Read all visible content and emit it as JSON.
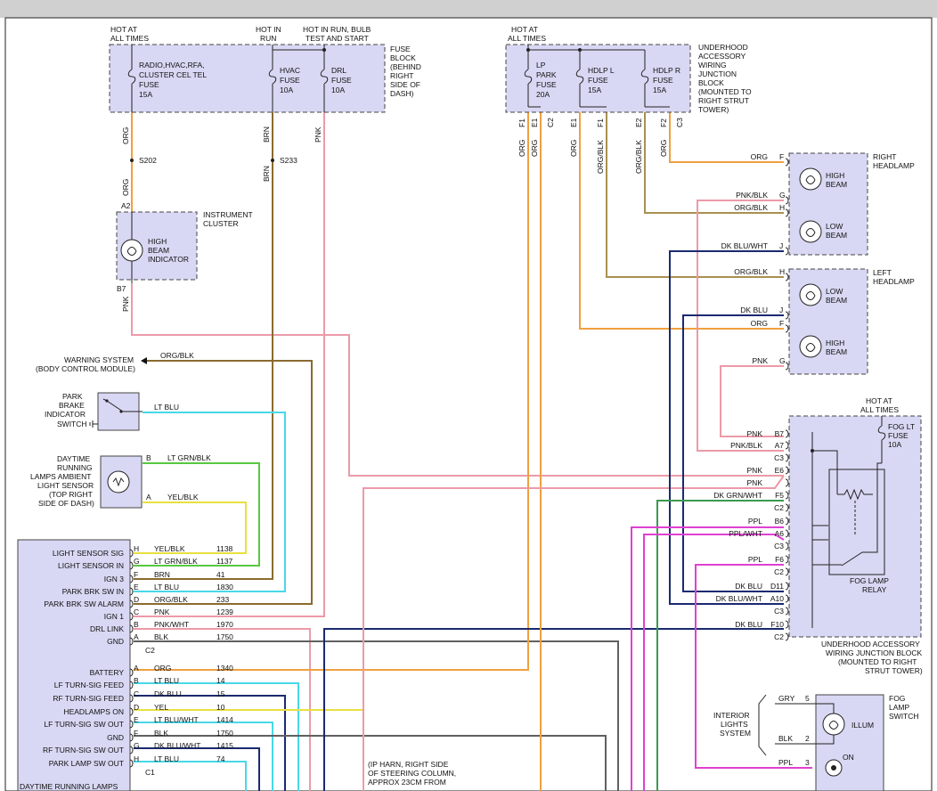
{
  "colors": {
    "org": "#f0a040",
    "brn": "#8a6a30",
    "pnk": "#ec9aa8",
    "ltblu": "#48d8e8",
    "ltgrn": "#58c840",
    "yel": "#e8e040",
    "ppl": "#e040d0",
    "dkblu": "#1a2a70",
    "dkgrn": "#3a9a50",
    "blk": "#606060",
    "box": "#d8d8f4"
  },
  "fuse_block": {
    "hot_at_all_times": [
      "HOT AT",
      "ALL TIMES"
    ],
    "hot_in_run": [
      "HOT IN",
      "RUN"
    ],
    "hot_in_run_bulb": [
      "HOT IN RUN, BULB",
      "TEST AND START"
    ],
    "radio_fuse": [
      "RADIO,HVAC,RFA,",
      "CLUSTER CEL TEL",
      "FUSE",
      "15A"
    ],
    "hvac_fuse": [
      "HVAC",
      "FUSE",
      "10A"
    ],
    "drl_fuse": [
      "DRL",
      "FUSE",
      "10A"
    ],
    "label": [
      "FUSE",
      "BLOCK",
      "(BEHIND",
      "RIGHT",
      "SIDE OF",
      "DASH)"
    ]
  },
  "underhood_block": {
    "hot": [
      "HOT AT",
      "ALL TIMES"
    ],
    "lp_park": [
      "LP",
      "PARK",
      "FUSE",
      "20A"
    ],
    "hdlp_l": [
      "HDLP L",
      "FUSE",
      "15A"
    ],
    "hdlp_r": [
      "HDLP R",
      "FUSE",
      "15A"
    ],
    "label": [
      "UNDERHOOD",
      "ACCESSORY",
      "WIRING",
      "JUNCTION",
      "BLOCK",
      "(MOUNTED TO",
      "RIGHT STRUT",
      "TOWER)"
    ],
    "pins": [
      "F1",
      "E1",
      "C2",
      "E1",
      "F1",
      "E2",
      "F2",
      "C3"
    ]
  },
  "wire_labels": {
    "org": "ORG",
    "brn": "BRN",
    "pnk": "PNK",
    "s202": "S202",
    "s233": "S233",
    "org_blk": "ORG/BLK",
    "a2": "A2",
    "b7": "B7"
  },
  "instrument_cluster": {
    "label": [
      "INSTRUMENT",
      "CLUSTER"
    ],
    "indicator": [
      "HIGH",
      "BEAM",
      "INDICATOR"
    ]
  },
  "warning_system": {
    "label": [
      "WARNING SYSTEM",
      "(BODY CONTROL MODULE)"
    ],
    "wire": "ORG/BLK"
  },
  "park_brake": {
    "label": [
      "PARK",
      "BRAKE",
      "INDICATOR",
      "SWITCH"
    ],
    "wire": "LT BLU"
  },
  "ambient_sensor": {
    "label": [
      "DAYTIME",
      "RUNNING",
      "LAMPS AMBIENT",
      "LIGHT SENSOR",
      "(TOP RIGHT",
      "SIDE OF DASH)"
    ],
    "pin_b": "B",
    "wire_b": "LT GRN/BLK",
    "pin_a": "A",
    "wire_a": "YEL/BLK"
  },
  "drl_module": {
    "rows_top": [
      {
        "label": "LIGHT SENSOR SIG",
        "pin": "H",
        "wire": "YEL/BLK",
        "circuit": "1138"
      },
      {
        "label": "LIGHT SENSOR IN",
        "pin": "G",
        "wire": "LT GRN/BLK",
        "circuit": "1137"
      },
      {
        "label": "IGN 3",
        "pin": "F",
        "wire": "BRN",
        "circuit": "41"
      },
      {
        "label": "PARK BRK SW IN",
        "pin": "E",
        "wire": "LT BLU",
        "circuit": "1830"
      },
      {
        "label": "PARK BRK SW ALARM",
        "pin": "D",
        "wire": "ORG/BLK",
        "circuit": "233"
      },
      {
        "label": "IGN 1",
        "pin": "C",
        "wire": "PNK",
        "circuit": "1239"
      },
      {
        "label": "DRL LINK",
        "pin": "B",
        "wire": "PNK/WHT",
        "circuit": "1970"
      },
      {
        "label": "GND",
        "pin": "A",
        "wire": "BLK",
        "circuit": "1750"
      }
    ],
    "connector_top": "C2",
    "rows_bottom": [
      {
        "label": "BATTERY",
        "pin": "A",
        "wire": "ORG",
        "circuit": "1340"
      },
      {
        "label": "LF TURN-SIG FEED",
        "pin": "B",
        "wire": "LT BLU",
        "circuit": "14"
      },
      {
        "label": "RF TURN-SIG FEED",
        "pin": "C",
        "wire": "DK BLU",
        "circuit": "15"
      },
      {
        "label": "HEADLAMPS ON",
        "pin": "D",
        "wire": "YEL",
        "circuit": "10"
      },
      {
        "label": "LF TURN-SIG SW OUT",
        "pin": "E",
        "wire": "LT BLU/WHT",
        "circuit": "1414"
      },
      {
        "label": "GND",
        "pin": "F",
        "wire": "BLK",
        "circuit": "1750"
      },
      {
        "label": "RF TURN-SIG SW OUT",
        "pin": "G",
        "wire": "DK BLU/WHT",
        "circuit": "1415"
      },
      {
        "label": "PARK LAMP SW OUT",
        "pin": "H",
        "wire": "LT BLU",
        "circuit": "74"
      }
    ],
    "connector_bottom": "C1",
    "footer": "DAYTIME RUNNING LAMPS"
  },
  "ip_harness_note": [
    "(IP HARN, RIGHT SIDE",
    "OF STEERING COLUMN,",
    "APPROX 23CM FROM"
  ],
  "right_headlamp": {
    "label": [
      "RIGHT",
      "HEADLAMP"
    ],
    "high": [
      "HIGH",
      "BEAM"
    ],
    "low": [
      "LOW",
      "BEAM"
    ],
    "pins": [
      {
        "wire": "ORG",
        "pin": "F"
      },
      {
        "wire": "PNK/BLK",
        "pin": "G"
      },
      {
        "wire": "ORG/BLK",
        "pin": "H"
      },
      {
        "wire": "DK BLU/WHT",
        "pin": "J"
      }
    ]
  },
  "left_headlamp": {
    "label": [
      "LEFT",
      "HEADLAMP"
    ],
    "low": [
      "LOW",
      "BEAM"
    ],
    "high": [
      "HIGH",
      "BEAM"
    ],
    "pins": [
      {
        "wire": "ORG/BLK",
        "pin": "H"
      },
      {
        "wire": "DK BLU",
        "pin": "J"
      },
      {
        "wire": "ORG",
        "pin": "F"
      },
      {
        "wire": "PNK",
        "pin": "G"
      }
    ]
  },
  "fog_relay_block": {
    "hot": [
      "HOT AT",
      "ALL TIMES"
    ],
    "fuse": [
      "FOG LT",
      "FUSE",
      "10A"
    ],
    "relay": [
      "FOG LAMP",
      "RELAY"
    ],
    "label": [
      "UNDERHOOD ACCESSORY",
      "WIRING JUNCTION BLOCK",
      "(MOUNTED TO RIGHT",
      "STRUT TOWER)"
    ],
    "pins": [
      {
        "wire": "PNK",
        "pin": "B7"
      },
      {
        "wire": "PNK/BLK",
        "pin": "A7"
      },
      {
        "wire": "",
        "pin": "C3"
      },
      {
        "wire": "PNK",
        "pin": "E6"
      },
      {
        "wire": "PNK",
        "pin": ""
      },
      {
        "wire": "DK GRN/WHT",
        "pin": "F5"
      },
      {
        "wire": "",
        "pin": "C2"
      },
      {
        "wire": "PPL",
        "pin": "B6"
      },
      {
        "wire": "PPL/WHT",
        "pin": "A6"
      },
      {
        "wire": "",
        "pin": "C3"
      },
      {
        "wire": "PPL",
        "pin": "F6"
      },
      {
        "wire": "",
        "pin": "C2"
      },
      {
        "wire": "DK BLU",
        "pin": "D11"
      },
      {
        "wire": "DK BLU/WHT",
        "pin": "A10"
      },
      {
        "wire": "",
        "pin": "C3"
      },
      {
        "wire": "DK BLU",
        "pin": "F10"
      },
      {
        "wire": "",
        "pin": "C2"
      }
    ]
  },
  "fog_switch": {
    "label": [
      "FOG",
      "LAMP",
      "SWITCH"
    ],
    "illum": "ILLUM",
    "on": "ON",
    "interior": [
      "INTERIOR",
      "LIGHTS",
      "SYSTEM"
    ],
    "pins": [
      {
        "wire": "GRY",
        "pin": "5"
      },
      {
        "wire": "BLK",
        "pin": "2"
      },
      {
        "wire": "PPL",
        "pin": "3"
      }
    ]
  }
}
